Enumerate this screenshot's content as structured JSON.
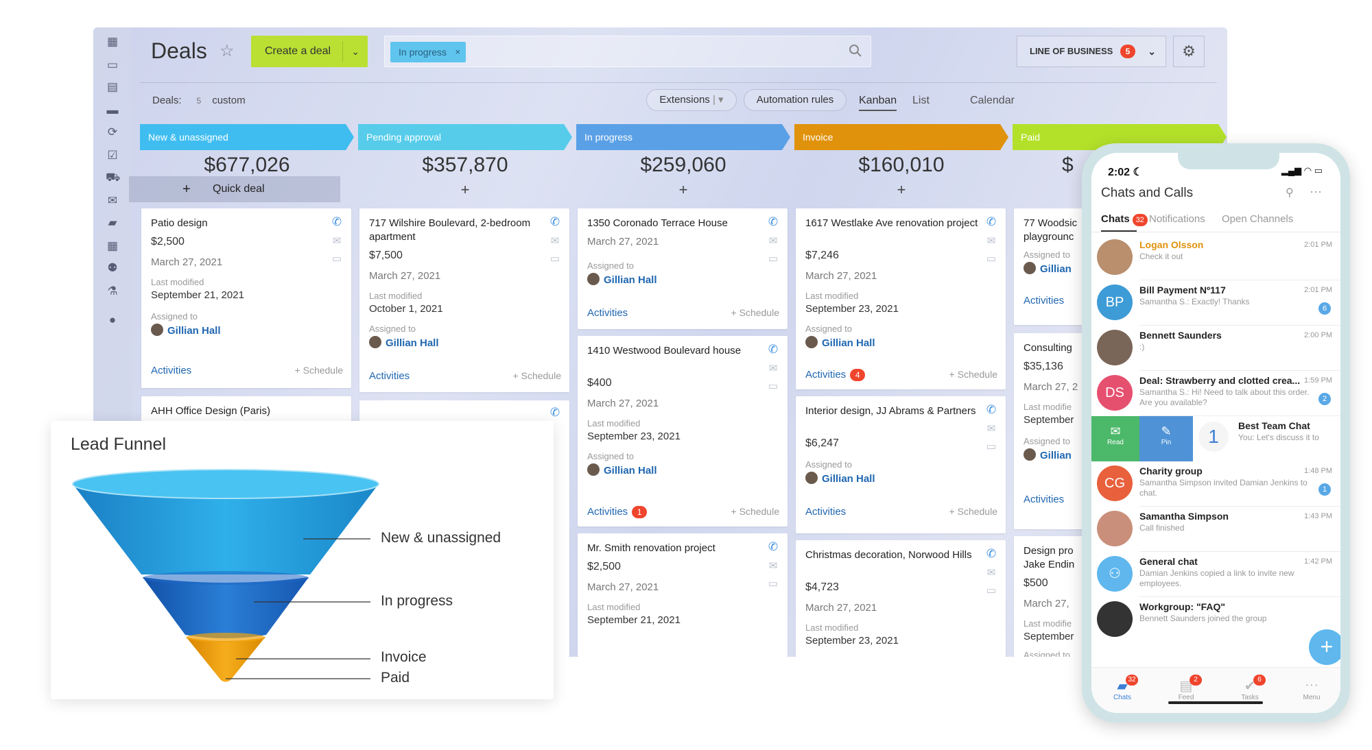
{
  "header": {
    "title": "Deals",
    "create_label": "Create a deal",
    "filter_chip": "In progress",
    "lob_label": "LINE OF BUSINESS",
    "lob_count": "5"
  },
  "toolbar": {
    "deals_label": "Deals:",
    "deals_count": "5",
    "deals_filter": "custom",
    "extensions": "Extensions",
    "automation": "Automation rules",
    "views": [
      "Kanban",
      "List",
      "Calendar"
    ]
  },
  "stages": [
    {
      "name": "New & unassigned",
      "sum": "$677,026",
      "color": "#3fbdf0"
    },
    {
      "name": "Pending approval",
      "sum": "$357,870",
      "color": "#56ccea"
    },
    {
      "name": "In progress",
      "sum": "$259,060",
      "color": "#5aa0e6"
    },
    {
      "name": "Invoice",
      "sum": "$160,010",
      "color": "#e0920c"
    },
    {
      "name": "Paid",
      "sum": "$",
      "color": "#b3e12a"
    }
  ],
  "quick_deal": "Quick deal",
  "common": {
    "last_modified": "Last modified",
    "assigned_to": "Assigned to",
    "activities": "Activities",
    "schedule": "+ Schedule",
    "person": "Gillian Hall"
  },
  "cards": {
    "c1": {
      "title": "Patio design",
      "price": "$2,500",
      "date": "March 27, 2021",
      "modified": "September 21, 2021"
    },
    "c1b": {
      "title": "AHH Office Design (Paris)"
    },
    "c2": {
      "title": "717 Wilshire Boulevard, 2-bedroom apartment",
      "price": "$7,500",
      "date": "March 27, 2021",
      "modified": "October 1, 2021"
    },
    "c3": {
      "title": "1350 Coronado Terrace House",
      "date": "March 27, 2021"
    },
    "c4": {
      "title": "1410 Westwood Boulevard house",
      "price": "$400",
      "date": "March 27, 2021",
      "modified": "September 23, 2021",
      "activities_count": "1"
    },
    "c5": {
      "title": "Mr. Smith renovation project",
      "price": "$2,500",
      "date": "March 27, 2021",
      "modified": "September 21, 2021"
    },
    "c6": {
      "title": "1617 Westlake Ave renovation project",
      "price": "$7,246",
      "date": "March 27, 2021",
      "modified": "September 23, 2021",
      "activities_count": "4"
    },
    "c7": {
      "title": "Interior design, JJ Abrams & Partners",
      "price": "$6,247"
    },
    "c8": {
      "title": "Christmas decoration, Norwood Hills",
      "price": "$4,723",
      "date": "March 27, 2021",
      "modified": "September 23, 2021"
    },
    "c9": {
      "title": "77 Woodsic playgrounc",
      "person": "Gillian"
    },
    "c10": {
      "title": "Consulting",
      "price": "$35,136",
      "date": "March 27, 2",
      "modified_lbl": "Last modifie",
      "modified": "September",
      "assigned_lbl": "Assigned to",
      "person": "Gillian"
    },
    "c11": {
      "title": "Design pro Jake Endin",
      "price": "$500",
      "date": "March 27,",
      "modified_lbl": "Last modifie",
      "modified": "September",
      "assigned_lbl": "Assigned to"
    }
  },
  "funnel": {
    "title": "Lead Funnel",
    "labels": [
      "New & unassigned",
      "In progress",
      "Invoice",
      "Paid"
    ]
  },
  "phone": {
    "time": "2:02",
    "title": "Chats and Calls",
    "tabs": [
      "Chats",
      "Notifications",
      "Open Channels"
    ],
    "chats_badge": "32",
    "chats": [
      {
        "name": "Logan Olsson",
        "msg": "Check it out",
        "time": "2:01 PM",
        "avatar": "",
        "color": "#b98f6e"
      },
      {
        "name": "Bill Payment Nº117",
        "msg": "Samantha S.: Exactly! Thanks",
        "time": "2:01 PM",
        "avatar": "BP",
        "color": "#3d9bd6",
        "count": "6"
      },
      {
        "name": "Bennett Saunders",
        "msg": ":)",
        "time": "2:00 PM",
        "avatar": "",
        "color": "#7a6658"
      },
      {
        "name": "Deal:  Strawberry and clotted crea...",
        "msg": "Samantha S.: Hi! Need to talk about this order. Are you available?",
        "time": "1:59 PM",
        "avatar": "DS",
        "color": "#e6506f",
        "count": "2"
      },
      {
        "name": "Best Team Chat",
        "msg": "You: Let's discuss it to",
        "time": "",
        "avatar": "",
        "color": "#f2f2f2"
      },
      {
        "name": "Charity group",
        "msg": "Samantha Simpson invited Damian Jenkins to chat.",
        "time": "1:48 PM",
        "avatar": "CG",
        "color": "#e8603c",
        "count": "1"
      },
      {
        "name": "Samantha Simpson",
        "msg": "Call finished",
        "time": "1:43 PM",
        "avatar": "",
        "color": "#c98f7a"
      },
      {
        "name": "General chat",
        "msg": "Damian Jenkins copied a link to invite new employees.",
        "time": "1:42 PM",
        "avatar": "",
        "color": "#5fb7ee"
      },
      {
        "name": "Workgroup: \"FAQ\"",
        "msg": "Bennett Saunders joined the group",
        "time": "",
        "avatar": "",
        "color": "#333"
      }
    ],
    "swipe": {
      "read": "Read",
      "pin": "Pin"
    },
    "nav": [
      {
        "label": "Chats",
        "badge": "32"
      },
      {
        "label": "Feed",
        "badge": "2"
      },
      {
        "label": "Tasks",
        "badge": "6"
      },
      {
        "label": "Menu",
        "badge": ""
      }
    ]
  }
}
